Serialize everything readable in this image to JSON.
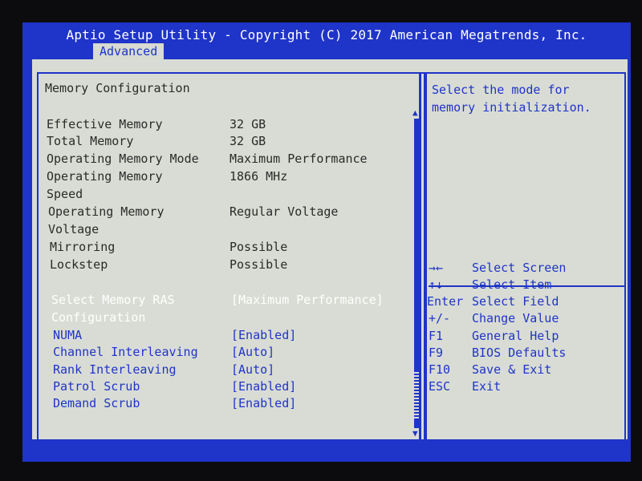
{
  "header": {
    "title": "Aptio Setup Utility - Copyright (C) 2017 American Megatrends, Inc.",
    "tab": "Advanced"
  },
  "section_title": "Memory Configuration",
  "info_rows": [
    {
      "label": "Effective Memory",
      "value": "32 GB"
    },
    {
      "label": "Total Memory",
      "value": "32 GB"
    },
    {
      "label": "Operating Memory Mode",
      "value": "Maximum Performance"
    },
    {
      "label": "Operating Memory",
      "label2": "Speed",
      "value": "1866 MHz"
    },
    {
      "label": "Operating Memory",
      "label2": "Voltage",
      "value": "Regular Voltage"
    },
    {
      "label": "Mirroring",
      "value": "Possible"
    },
    {
      "label": "Lockstep",
      "value": "Possible"
    }
  ],
  "settings": [
    {
      "label": "Select Memory RAS",
      "label2": "Configuration",
      "value": "[Maximum Performance]",
      "selected": true
    },
    {
      "label": "NUMA",
      "value": "[Enabled]"
    },
    {
      "label": "Channel Interleaving",
      "value": "[Auto]"
    },
    {
      "label": "Rank Interleaving",
      "value": "[Auto]"
    },
    {
      "label": "Patrol Scrub",
      "value": "[Enabled]"
    },
    {
      "label": "Demand Scrub",
      "value": "[Enabled]"
    }
  ],
  "help_text": [
    "Select the mode for",
    "memory initialization."
  ],
  "keys": [
    {
      "key": "→←",
      "desc": "Select Screen"
    },
    {
      "key": "↑↓",
      "desc": "Select Item"
    },
    {
      "key": "Enter",
      "desc": "Select Field"
    },
    {
      "key": "+/-",
      "desc": "Change Value"
    },
    {
      "key": "F1",
      "desc": "General Help"
    },
    {
      "key": "F9",
      "desc": "BIOS Defaults"
    },
    {
      "key": "F10",
      "desc": "Save & Exit"
    },
    {
      "key": "ESC",
      "desc": "Exit"
    }
  ],
  "icons": {
    "scroll_up": "▲",
    "scroll_down": "▼"
  },
  "colors": {
    "frame_blue": "#1f34c8",
    "panel_gray": "#d9dcd4",
    "selected_text": "#ffffff"
  }
}
